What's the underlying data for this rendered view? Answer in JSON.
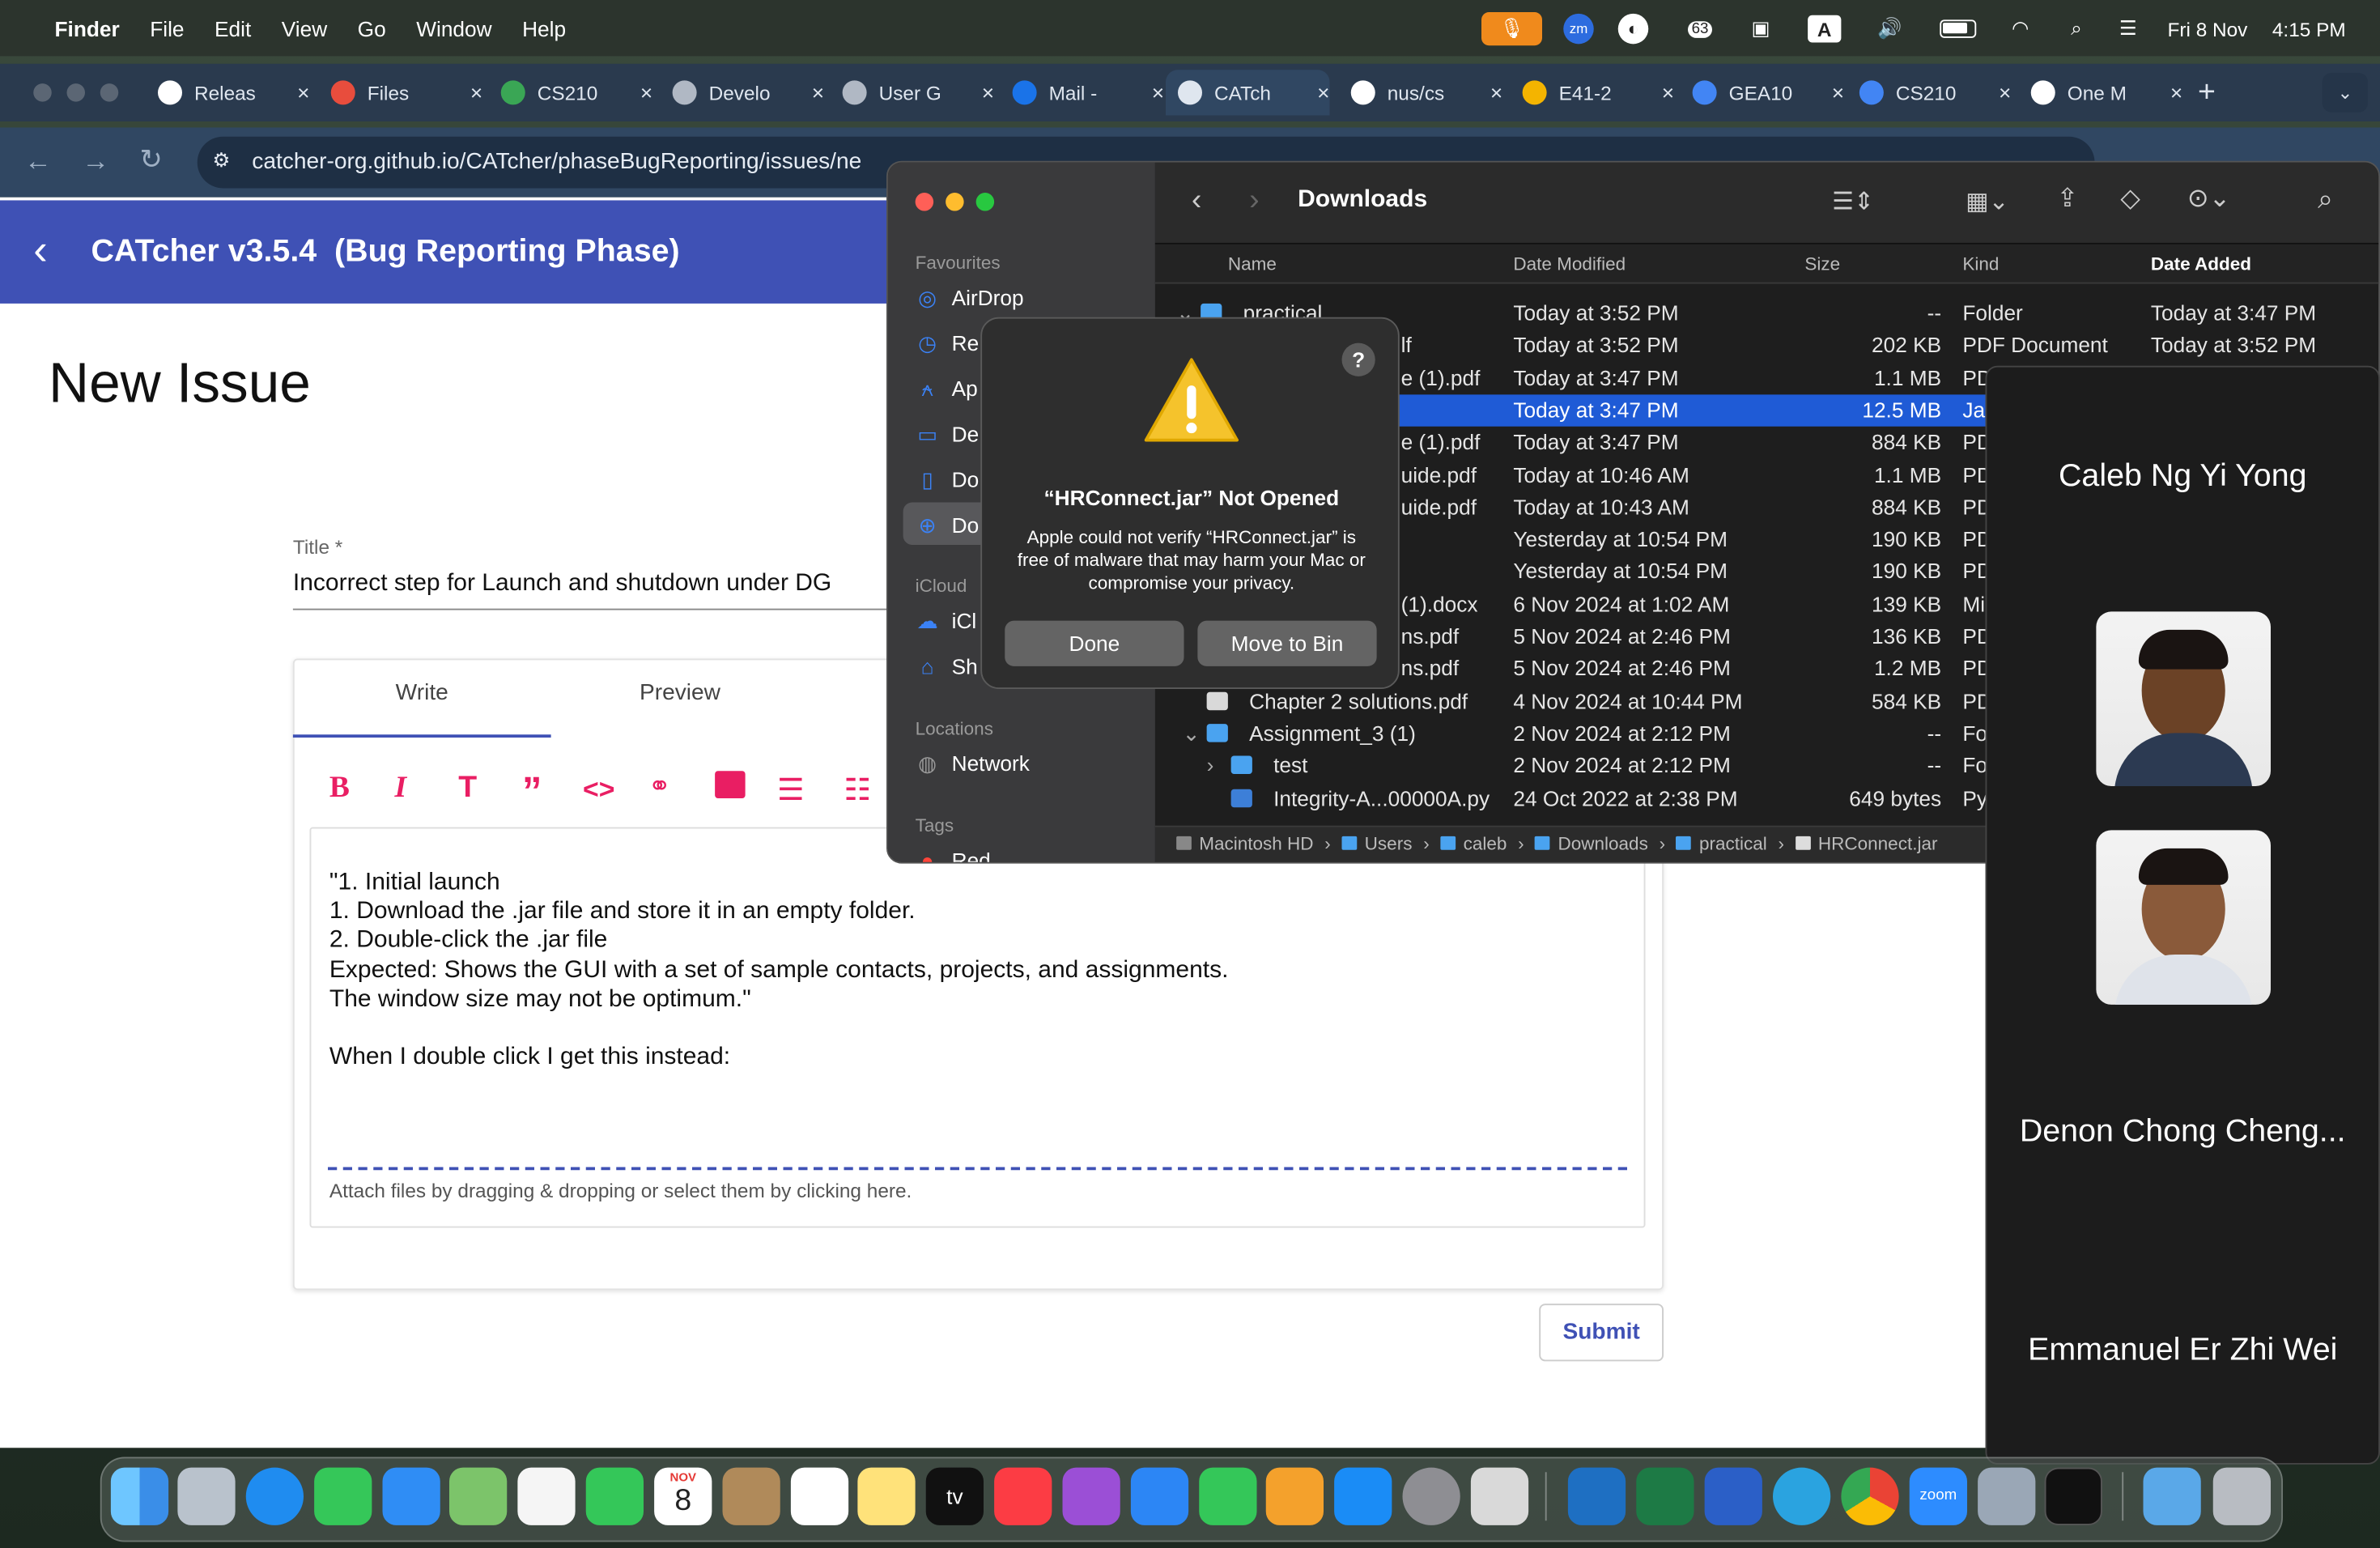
{
  "menubar": {
    "apple": "",
    "items": [
      "Finder",
      "File",
      "Edit",
      "View",
      "Go",
      "Window",
      "Help"
    ],
    "status": {
      "zm_icon": "zm",
      "badge": "63",
      "keyboard": "A",
      "date": "Fri 8 Nov",
      "time": "4:15 PM"
    }
  },
  "browser": {
    "tabs": [
      {
        "label": "Releas",
        "icon": "github-icon"
      },
      {
        "label": "Files",
        "icon": "gear-icon"
      },
      {
        "label": "CS210",
        "icon": "grad-cap-icon"
      },
      {
        "label": "Develo",
        "icon": "globe-icon"
      },
      {
        "label": "User G",
        "icon": "globe-icon"
      },
      {
        "label": "Mail -",
        "icon": "outlook-icon"
      },
      {
        "label": "CATch",
        "icon": "catcher-icon"
      },
      {
        "label": "nus/cs",
        "icon": "github-icon"
      },
      {
        "label": "E41-2",
        "icon": "slides-icon"
      },
      {
        "label": "GEA10",
        "icon": "docs-icon"
      },
      {
        "label": "CS210",
        "icon": "docs-icon"
      },
      {
        "label": "One M",
        "icon": "gmail-icon"
      }
    ],
    "url": "catcher-org.github.io/CATcher/phaseBugReporting/issues/ne"
  },
  "catcher": {
    "app_title": "CATcher v3.5.4  (Bug Reporting Phase)",
    "page_title": "New Issue",
    "title_label": "Title *",
    "title_value": "Incorrect step for Launch and shutdown under DG",
    "tab_write": "Write",
    "tab_preview": "Preview",
    "body_lines": [
      "\"1. Initial launch",
      "1. Download the .jar file and store it in an empty folder.",
      "2. Double-click the .jar file",
      "Expected: Shows the GUI with a set of sample contacts, projects, and assignments.",
      "The window size may not be optimum.\"",
      "",
      "When I double click I get this instead:"
    ],
    "attach_hint": "Attach files by dragging & dropping or select them by clicking here.",
    "submit": "Submit"
  },
  "finder": {
    "title": "Downloads",
    "sidebar": {
      "favourites_header": "Favourites",
      "favourites": [
        "AirDrop",
        "Re",
        "Ap",
        "De",
        "Do",
        "Do"
      ],
      "icloud_header": "iCloud",
      "icloud": [
        "iCl",
        "Sh"
      ],
      "locations_header": "Locations",
      "locations": [
        "Network"
      ],
      "tags_header": "Tags",
      "tags": [
        "Red"
      ]
    },
    "columns": [
      "Name",
      "Date Modified",
      "Size",
      "Kind",
      "Date Added"
    ],
    "rows": [
      {
        "name": "practical",
        "date": "Today at 3:52 PM",
        "size": "--",
        "kind": "Folder",
        "added": "Today at 3:47 PM"
      },
      {
        "name": "lf",
        "date": "Today at 3:52 PM",
        "size": "202 KB",
        "kind": "PDF Document",
        "added": "Today at 3:52 PM"
      },
      {
        "name": "e (1).pdf",
        "date": "Today at 3:47 PM",
        "size": "1.1 MB",
        "kind": "PD",
        "added": ""
      },
      {
        "name": "",
        "date": "Today at 3:47 PM",
        "size": "12.5 MB",
        "kind": "Ja",
        "added": ""
      },
      {
        "name": "e (1).pdf",
        "date": "Today at 3:47 PM",
        "size": "884 KB",
        "kind": "PD",
        "added": ""
      },
      {
        "name": "uide.pdf",
        "date": "Today at 10:46 AM",
        "size": "1.1 MB",
        "kind": "PD",
        "added": ""
      },
      {
        "name": "uide.pdf",
        "date": "Today at 10:43 AM",
        "size": "884 KB",
        "kind": "PD",
        "added": ""
      },
      {
        "name": "",
        "date": "Yesterday at 10:54 PM",
        "size": "190 KB",
        "kind": "PD",
        "added": ""
      },
      {
        "name": "",
        "date": "Yesterday at 10:54 PM",
        "size": "190 KB",
        "kind": "PD",
        "added": ""
      },
      {
        "name": "(1).docx",
        "date": "6 Nov 2024 at 1:02 AM",
        "size": "139 KB",
        "kind": "Mi",
        "added": ""
      },
      {
        "name": "ns.pdf",
        "date": "5 Nov 2024 at 2:46 PM",
        "size": "136 KB",
        "kind": "PD",
        "added": ""
      },
      {
        "name": "ns.pdf",
        "date": "5 Nov 2024 at 2:46 PM",
        "size": "1.2 MB",
        "kind": "PD",
        "added": ""
      },
      {
        "name": "Chapter 2 solutions.pdf",
        "date": "4 Nov 2024 at 10:44 PM",
        "size": "584 KB",
        "kind": "PD",
        "added": ""
      },
      {
        "name": "Assignment_3 (1)",
        "date": "2 Nov 2024 at 2:12 PM",
        "size": "--",
        "kind": "Fo",
        "added": ""
      },
      {
        "name": "test",
        "date": "2 Nov 2024 at 2:12 PM",
        "size": "--",
        "kind": "Fo",
        "added": ""
      },
      {
        "name": "Integrity-A...00000A.py",
        "date": "24 Oct 2022 at 2:38 PM",
        "size": "649 bytes",
        "kind": "Py",
        "added": ""
      }
    ],
    "path": [
      "Macintosh HD",
      "Users",
      "caleb",
      "Downloads",
      "practical",
      "HRConnect.jar"
    ]
  },
  "dialog": {
    "help": "?",
    "title": "“HRConnect.jar” Not Opened",
    "message": "Apple could not verify “HRConnect.jar” is free of malware that may harm your Mac or compromise your privacy.",
    "done": "Done",
    "move": "Move to Bin"
  },
  "zoom": {
    "participants": [
      "Caleb Ng Yi Yong",
      "Denon Chong Cheng...",
      "Emmanuel Er Zhi Wei"
    ]
  },
  "dock": {
    "calendar_month": "NOV",
    "calendar_day": "8",
    "tv_label": "tv",
    "zoom_label": "zoom"
  }
}
